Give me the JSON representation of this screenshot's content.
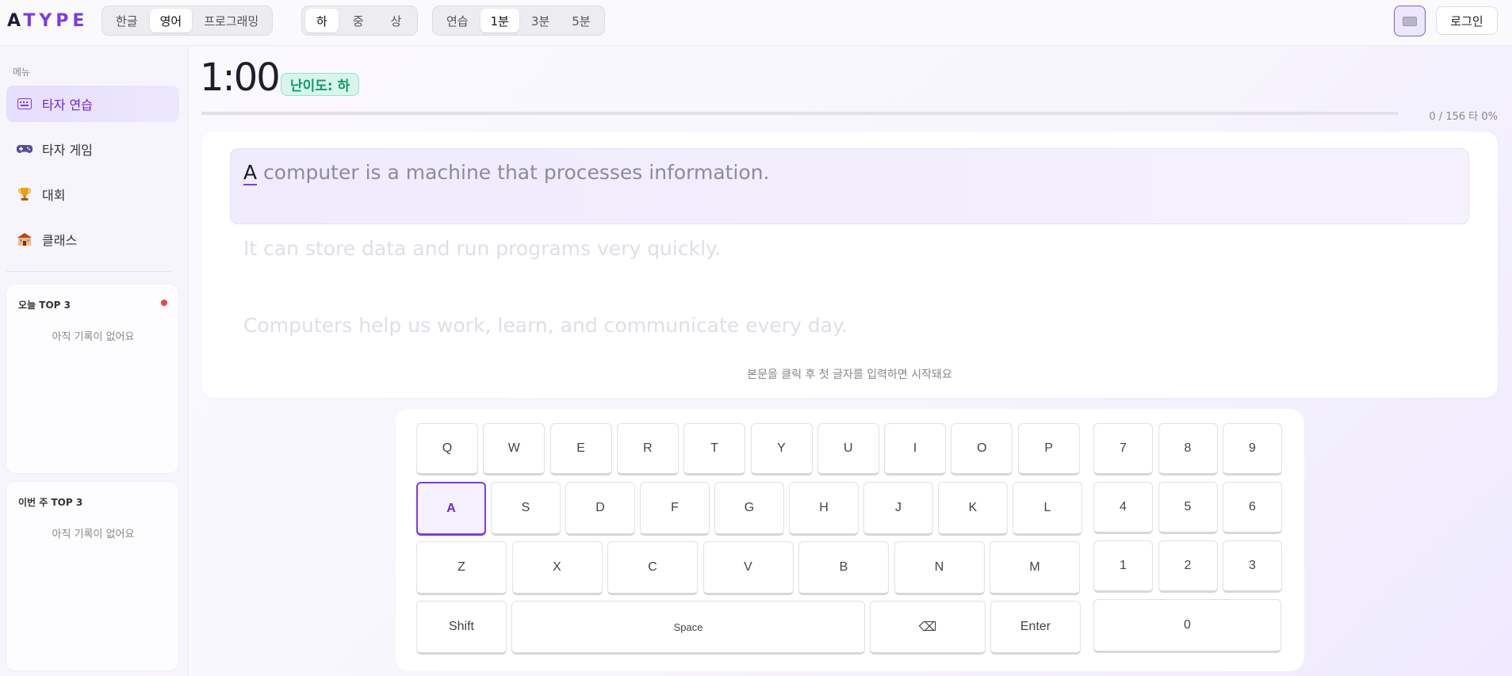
{
  "app": {
    "logo_first": "A",
    "logo_rest": "TYPE"
  },
  "header": {
    "language_tabs": [
      "한글",
      "영어",
      "프로그래밍"
    ],
    "language_selected": "영어",
    "difficulty_tabs": [
      "하",
      "중",
      "상"
    ],
    "difficulty_selected": "하",
    "mode_tabs": [
      "연습",
      "1분",
      "3분",
      "5분"
    ],
    "mode_selected": "1분",
    "keyboard_toggle_icon": "keyboard-icon",
    "login_label": "로그인"
  },
  "sidebar": {
    "menu_label": "메뉴",
    "items": [
      {
        "label": "타자 연습",
        "icon": "keyboard-icon",
        "active": true
      },
      {
        "label": "타자 게임",
        "icon": "gamepad-icon",
        "active": false
      },
      {
        "label": "대회",
        "icon": "trophy-icon",
        "active": false
      },
      {
        "label": "클래스",
        "icon": "school-icon",
        "active": false
      }
    ],
    "today_top": {
      "title": "오늘 TOP 3",
      "empty": "아직 기록이 없어요"
    },
    "week_top": {
      "title": "이번 주 TOP 3",
      "empty": "아직 기록이 없어요"
    }
  },
  "main": {
    "timer": "1:00",
    "difficulty_badge": "난이도: 하",
    "progress_fraction": 0,
    "stats": "0 / 156 타 0%",
    "lines": [
      {
        "current_char": "A",
        "rest": " computer is a machine that processes information."
      },
      {
        "text": "It can store data and run programs very quickly."
      },
      {
        "text": "Computers help us work, learn, and communicate every day."
      }
    ],
    "hint": "본문을 클릭 후 첫 글자를 입력하면 시작돼요"
  },
  "keyboard": {
    "row1": [
      "Q",
      "W",
      "E",
      "R",
      "T",
      "Y",
      "U",
      "I",
      "O",
      "P"
    ],
    "row2": [
      "A",
      "S",
      "D",
      "F",
      "G",
      "H",
      "J",
      "K",
      "L"
    ],
    "row3": [
      "Z",
      "X",
      "C",
      "V",
      "B",
      "N",
      "M"
    ],
    "row4": [
      "Shift",
      "Space",
      "⌫",
      "Enter"
    ],
    "numpad": [
      [
        "7",
        "8",
        "9"
      ],
      [
        "4",
        "5",
        "6"
      ],
      [
        "1",
        "2",
        "3"
      ],
      [
        "0"
      ]
    ],
    "highlighted_key": "A"
  },
  "colors": {
    "accent": "#7c3aed",
    "badge_green": "#0f9a6b",
    "rank_dot": "#ef4444"
  }
}
